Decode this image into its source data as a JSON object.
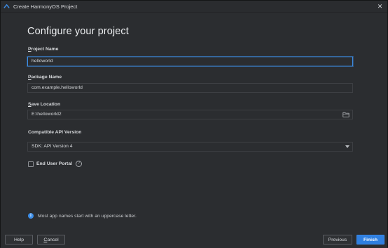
{
  "window": {
    "title": "Create HarmonyOS Project",
    "close_glyph": "✕"
  },
  "heading": "Configure your project",
  "fields": {
    "project_name": {
      "label_underlined": "P",
      "label_rest": "roject Name",
      "value": "helloworld"
    },
    "package_name": {
      "label_underlined": "P",
      "label_rest": "ackage Name",
      "value": "com.example.helloworld"
    },
    "save_location": {
      "label_underlined": "S",
      "label_rest": "ave Location",
      "value": "E:\\helloworld2"
    },
    "compatible_api": {
      "label": "Compatible API Version",
      "value": "SDK: API Version 4"
    }
  },
  "end_user_portal": {
    "label": "End User Portal",
    "checked": false,
    "help_glyph": "?"
  },
  "hint": {
    "icon_glyph": "i",
    "text": "Most app names start with an uppercase letter."
  },
  "buttons": {
    "help": "Help",
    "cancel_underlined": "C",
    "cancel_rest": "ancel",
    "previous": "Previous",
    "previous_underlined": "",
    "finish": "Finish"
  },
  "colors": {
    "accent": "#2f7fe0",
    "background": "#2b2d30",
    "focus_border": "#3d8ee8"
  },
  "icons": {
    "app": "harmonyos-logo-icon",
    "close": "close-icon",
    "folder": "folder-icon",
    "dropdown": "chevron-down-icon",
    "help": "help-icon",
    "info": "info-icon"
  }
}
